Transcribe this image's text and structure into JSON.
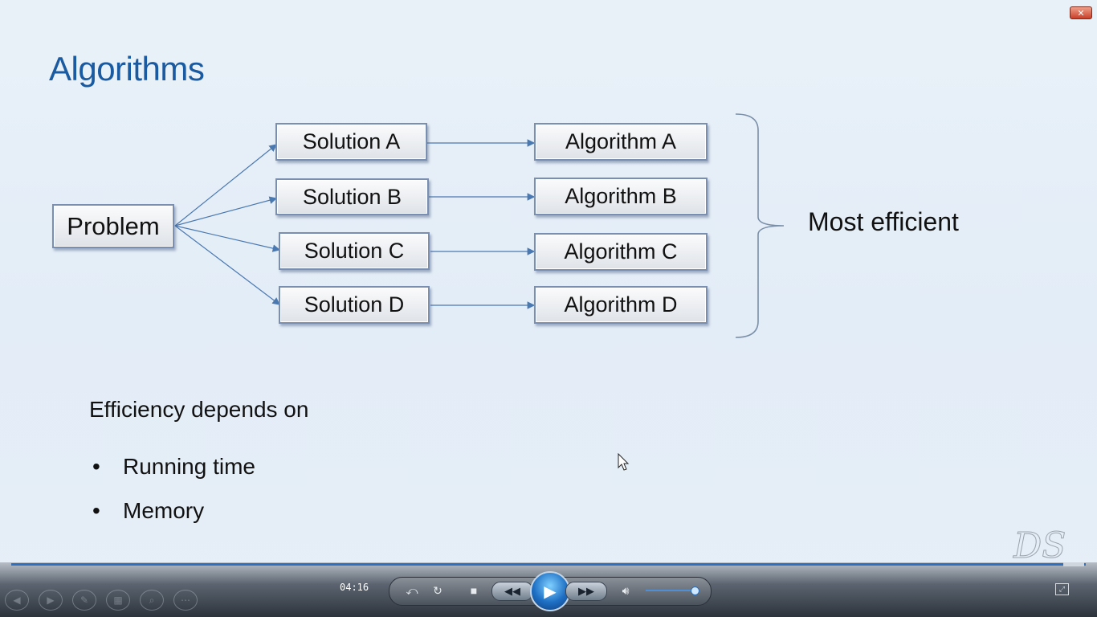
{
  "slide": {
    "title": "Algorithms",
    "problem": "Problem",
    "solutions": [
      "Solution A",
      "Solution B",
      "Solution C",
      "Solution D"
    ],
    "algorithms": [
      "Algorithm A",
      "Algorithm B",
      "Algorithm C",
      "Algorithm D"
    ],
    "most_efficient": "Most efficient",
    "efficiency_heading": "Efficiency depends on",
    "bullets": [
      "Running time",
      "Memory"
    ],
    "bullet_glyph": "•",
    "watermark": "DS"
  },
  "player": {
    "time": "04:16",
    "icons": {
      "switch": "switch-view-icon",
      "repeat": "repeat-icon",
      "stop": "stop-icon",
      "rewind": "rewind-icon",
      "play": "play-icon",
      "forward": "fast-forward-icon",
      "volume": "volume-icon",
      "fullscreen": "fullscreen-icon",
      "close": "close-icon"
    },
    "accent": "#2f6fbf"
  }
}
